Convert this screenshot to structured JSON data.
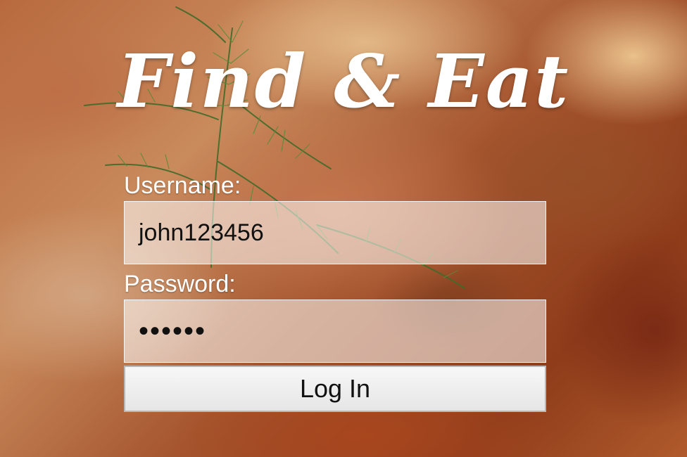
{
  "app": {
    "title": "Find & Eat"
  },
  "login_form": {
    "username_label": "Username:",
    "username_value": "john123456",
    "password_label": "Password:",
    "password_value_masked": "••••••",
    "submit_label": "Log In"
  },
  "colors": {
    "title_text": "#ffffff",
    "label_text": "#ffffff",
    "field_background": "#ffffff8c",
    "button_background": "#eeeeee",
    "button_border": "#b8b8b8"
  },
  "background": {
    "description_icon": "food-photo-background"
  }
}
